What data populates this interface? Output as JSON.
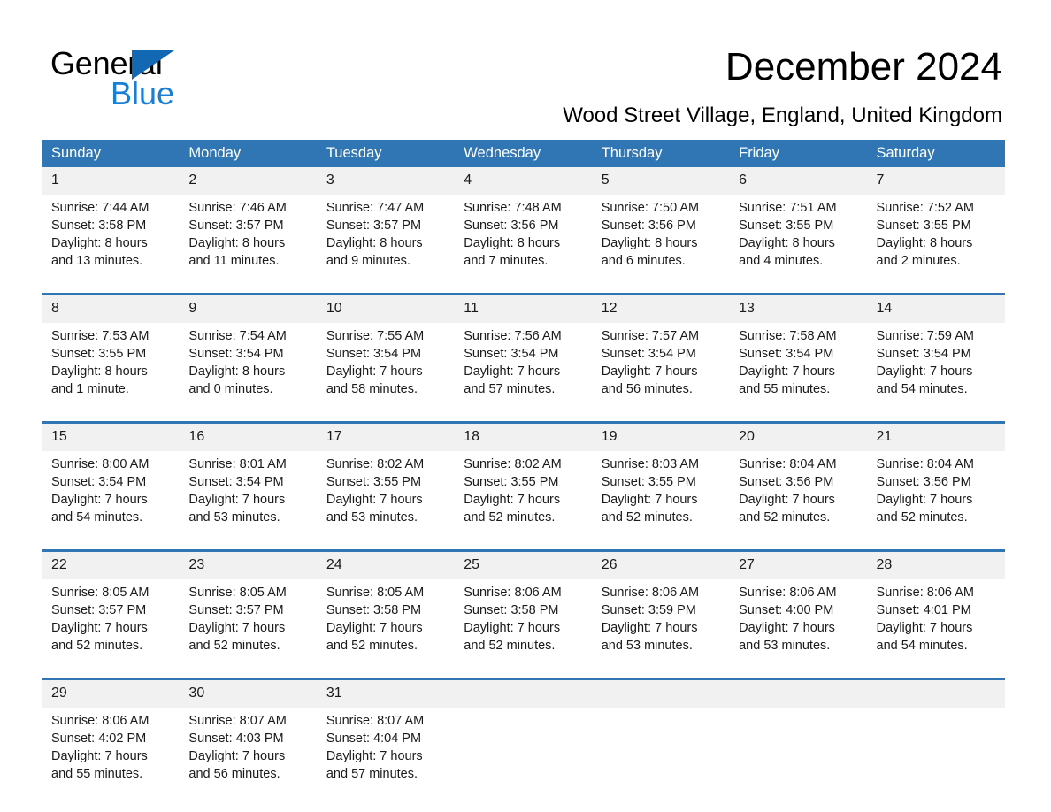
{
  "brand": {
    "name_part1": "General",
    "name_part2": "Blue",
    "triangle_color": "#1268b3",
    "blue_text_color": "#1a7fd4"
  },
  "header": {
    "title": "December 2024",
    "subtitle": "Wood Street Village, England, United Kingdom"
  },
  "theme": {
    "header_blue": "#3076b4",
    "daynum_gray": "#f1f1f1",
    "separator_blue": "#3076b4",
    "text_black": "#1a1a1a",
    "background": "#ffffff"
  },
  "weekday_headers": [
    "Sunday",
    "Monday",
    "Tuesday",
    "Wednesday",
    "Thursday",
    "Friday",
    "Saturday"
  ],
  "weeks": [
    {
      "days": [
        {
          "num": "1",
          "sunrise": "Sunrise: 7:44 AM",
          "sunset": "Sunset: 3:58 PM",
          "daylight1": "Daylight: 8 hours",
          "daylight2": "and 13 minutes."
        },
        {
          "num": "2",
          "sunrise": "Sunrise: 7:46 AM",
          "sunset": "Sunset: 3:57 PM",
          "daylight1": "Daylight: 8 hours",
          "daylight2": "and 11 minutes."
        },
        {
          "num": "3",
          "sunrise": "Sunrise: 7:47 AM",
          "sunset": "Sunset: 3:57 PM",
          "daylight1": "Daylight: 8 hours",
          "daylight2": "and 9 minutes."
        },
        {
          "num": "4",
          "sunrise": "Sunrise: 7:48 AM",
          "sunset": "Sunset: 3:56 PM",
          "daylight1": "Daylight: 8 hours",
          "daylight2": "and 7 minutes."
        },
        {
          "num": "5",
          "sunrise": "Sunrise: 7:50 AM",
          "sunset": "Sunset: 3:56 PM",
          "daylight1": "Daylight: 8 hours",
          "daylight2": "and 6 minutes."
        },
        {
          "num": "6",
          "sunrise": "Sunrise: 7:51 AM",
          "sunset": "Sunset: 3:55 PM",
          "daylight1": "Daylight: 8 hours",
          "daylight2": "and 4 minutes."
        },
        {
          "num": "7",
          "sunrise": "Sunrise: 7:52 AM",
          "sunset": "Sunset: 3:55 PM",
          "daylight1": "Daylight: 8 hours",
          "daylight2": "and 2 minutes."
        }
      ]
    },
    {
      "days": [
        {
          "num": "8",
          "sunrise": "Sunrise: 7:53 AM",
          "sunset": "Sunset: 3:55 PM",
          "daylight1": "Daylight: 8 hours",
          "daylight2": "and 1 minute."
        },
        {
          "num": "9",
          "sunrise": "Sunrise: 7:54 AM",
          "sunset": "Sunset: 3:54 PM",
          "daylight1": "Daylight: 8 hours",
          "daylight2": "and 0 minutes."
        },
        {
          "num": "10",
          "sunrise": "Sunrise: 7:55 AM",
          "sunset": "Sunset: 3:54 PM",
          "daylight1": "Daylight: 7 hours",
          "daylight2": "and 58 minutes."
        },
        {
          "num": "11",
          "sunrise": "Sunrise: 7:56 AM",
          "sunset": "Sunset: 3:54 PM",
          "daylight1": "Daylight: 7 hours",
          "daylight2": "and 57 minutes."
        },
        {
          "num": "12",
          "sunrise": "Sunrise: 7:57 AM",
          "sunset": "Sunset: 3:54 PM",
          "daylight1": "Daylight: 7 hours",
          "daylight2": "and 56 minutes."
        },
        {
          "num": "13",
          "sunrise": "Sunrise: 7:58 AM",
          "sunset": "Sunset: 3:54 PM",
          "daylight1": "Daylight: 7 hours",
          "daylight2": "and 55 minutes."
        },
        {
          "num": "14",
          "sunrise": "Sunrise: 7:59 AM",
          "sunset": "Sunset: 3:54 PM",
          "daylight1": "Daylight: 7 hours",
          "daylight2": "and 54 minutes."
        }
      ]
    },
    {
      "days": [
        {
          "num": "15",
          "sunrise": "Sunrise: 8:00 AM",
          "sunset": "Sunset: 3:54 PM",
          "daylight1": "Daylight: 7 hours",
          "daylight2": "and 54 minutes."
        },
        {
          "num": "16",
          "sunrise": "Sunrise: 8:01 AM",
          "sunset": "Sunset: 3:54 PM",
          "daylight1": "Daylight: 7 hours",
          "daylight2": "and 53 minutes."
        },
        {
          "num": "17",
          "sunrise": "Sunrise: 8:02 AM",
          "sunset": "Sunset: 3:55 PM",
          "daylight1": "Daylight: 7 hours",
          "daylight2": "and 53 minutes."
        },
        {
          "num": "18",
          "sunrise": "Sunrise: 8:02 AM",
          "sunset": "Sunset: 3:55 PM",
          "daylight1": "Daylight: 7 hours",
          "daylight2": "and 52 minutes."
        },
        {
          "num": "19",
          "sunrise": "Sunrise: 8:03 AM",
          "sunset": "Sunset: 3:55 PM",
          "daylight1": "Daylight: 7 hours",
          "daylight2": "and 52 minutes."
        },
        {
          "num": "20",
          "sunrise": "Sunrise: 8:04 AM",
          "sunset": "Sunset: 3:56 PM",
          "daylight1": "Daylight: 7 hours",
          "daylight2": "and 52 minutes."
        },
        {
          "num": "21",
          "sunrise": "Sunrise: 8:04 AM",
          "sunset": "Sunset: 3:56 PM",
          "daylight1": "Daylight: 7 hours",
          "daylight2": "and 52 minutes."
        }
      ]
    },
    {
      "days": [
        {
          "num": "22",
          "sunrise": "Sunrise: 8:05 AM",
          "sunset": "Sunset: 3:57 PM",
          "daylight1": "Daylight: 7 hours",
          "daylight2": "and 52 minutes."
        },
        {
          "num": "23",
          "sunrise": "Sunrise: 8:05 AM",
          "sunset": "Sunset: 3:57 PM",
          "daylight1": "Daylight: 7 hours",
          "daylight2": "and 52 minutes."
        },
        {
          "num": "24",
          "sunrise": "Sunrise: 8:05 AM",
          "sunset": "Sunset: 3:58 PM",
          "daylight1": "Daylight: 7 hours",
          "daylight2": "and 52 minutes."
        },
        {
          "num": "25",
          "sunrise": "Sunrise: 8:06 AM",
          "sunset": "Sunset: 3:58 PM",
          "daylight1": "Daylight: 7 hours",
          "daylight2": "and 52 minutes."
        },
        {
          "num": "26",
          "sunrise": "Sunrise: 8:06 AM",
          "sunset": "Sunset: 3:59 PM",
          "daylight1": "Daylight: 7 hours",
          "daylight2": "and 53 minutes."
        },
        {
          "num": "27",
          "sunrise": "Sunrise: 8:06 AM",
          "sunset": "Sunset: 4:00 PM",
          "daylight1": "Daylight: 7 hours",
          "daylight2": "and 53 minutes."
        },
        {
          "num": "28",
          "sunrise": "Sunrise: 8:06 AM",
          "sunset": "Sunset: 4:01 PM",
          "daylight1": "Daylight: 7 hours",
          "daylight2": "and 54 minutes."
        }
      ]
    },
    {
      "days": [
        {
          "num": "29",
          "sunrise": "Sunrise: 8:06 AM",
          "sunset": "Sunset: 4:02 PM",
          "daylight1": "Daylight: 7 hours",
          "daylight2": "and 55 minutes."
        },
        {
          "num": "30",
          "sunrise": "Sunrise: 8:07 AM",
          "sunset": "Sunset: 4:03 PM",
          "daylight1": "Daylight: 7 hours",
          "daylight2": "and 56 minutes."
        },
        {
          "num": "31",
          "sunrise": "Sunrise: 8:07 AM",
          "sunset": "Sunset: 4:04 PM",
          "daylight1": "Daylight: 7 hours",
          "daylight2": "and 57 minutes."
        },
        {
          "num": "",
          "sunrise": "",
          "sunset": "",
          "daylight1": "",
          "daylight2": ""
        },
        {
          "num": "",
          "sunrise": "",
          "sunset": "",
          "daylight1": "",
          "daylight2": ""
        },
        {
          "num": "",
          "sunrise": "",
          "sunset": "",
          "daylight1": "",
          "daylight2": ""
        },
        {
          "num": "",
          "sunrise": "",
          "sunset": "",
          "daylight1": "",
          "daylight2": ""
        }
      ]
    }
  ]
}
